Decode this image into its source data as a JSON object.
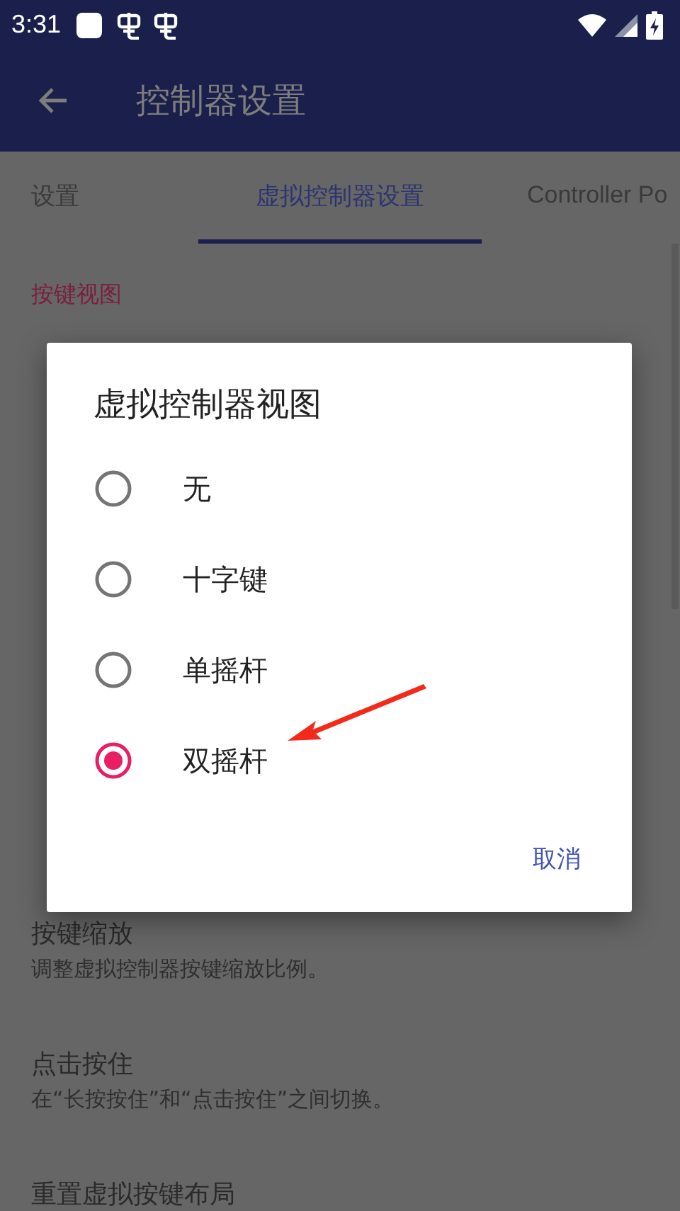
{
  "status_bar": {
    "time": "3:31"
  },
  "toolbar": {
    "title": "控制器设置"
  },
  "tabs": [
    {
      "label": "设置",
      "selected": false
    },
    {
      "label": "虚拟控制器设置",
      "selected": true
    },
    {
      "label": "Controller Po",
      "selected": false
    }
  ],
  "section_header": "按键视图",
  "settings": [
    {
      "title": "按键缩放",
      "summary": "调整虚拟控制器按键缩放比例。"
    },
    {
      "title": "点击按住",
      "summary": "在“长按按住”和“点击按住”之间切换。"
    },
    {
      "title": "重置虚拟按键布局"
    }
  ],
  "dialog": {
    "title": "虚拟控制器视图",
    "options": [
      {
        "label": "无",
        "selected": false
      },
      {
        "label": "十字键",
        "selected": false
      },
      {
        "label": "单摇杆",
        "selected": false
      },
      {
        "label": "双摇杆",
        "selected": true
      }
    ],
    "buttons": [
      "取消"
    ]
  }
}
